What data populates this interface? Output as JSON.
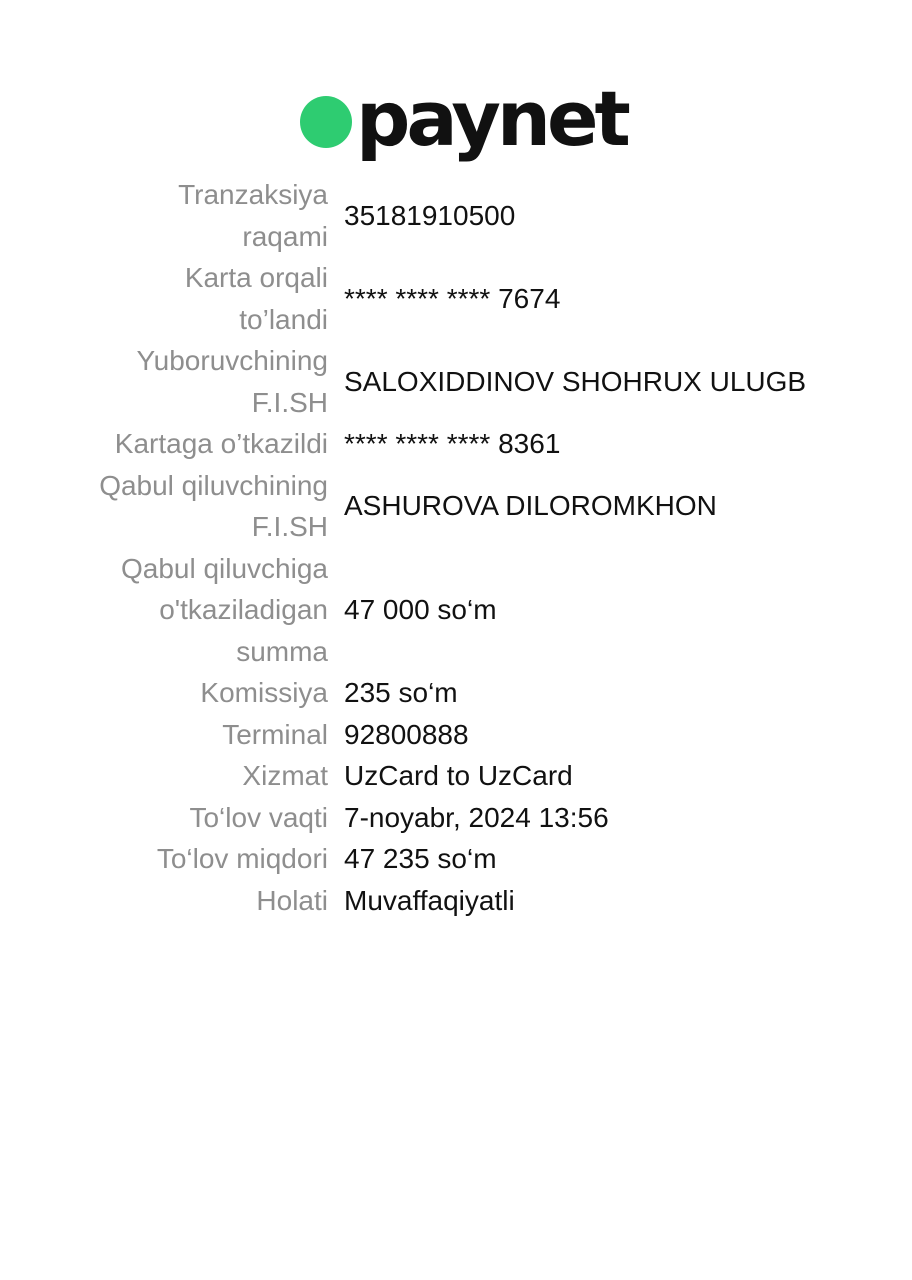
{
  "brand": {
    "name": "paynet",
    "accent_color": "#2ecc71"
  },
  "receipt": {
    "rows": [
      {
        "label": "Tranzaksiya raqami",
        "value": "35181910500"
      },
      {
        "label": "Karta orqali to’landi",
        "value": "**** **** **** 7674"
      },
      {
        "label": "Yuboruvchining F.I.SH",
        "value": "SALOXIDDINOV SHOHRUX ULUGB"
      },
      {
        "label": "Kartaga o’tkazildi",
        "value": "**** **** **** 8361"
      },
      {
        "label": "Qabul qiluvchining F.I.SH",
        "value": "ASHUROVA DILOROMKHON"
      },
      {
        "label": "Qabul qiluvchiga o'tkaziladigan summa",
        "value": "47 000 so‘m"
      },
      {
        "label": "Komissiya",
        "value": "235 so‘m"
      },
      {
        "label": "Terminal",
        "value": "92800888"
      },
      {
        "label": "Xizmat",
        "value": "UzCard to UzCard"
      },
      {
        "label": "To‘lov vaqti",
        "value": "7-noyabr, 2024 13:56"
      },
      {
        "label": "To‘lov miqdori",
        "value": "47 235 so‘m"
      },
      {
        "label": "Holati",
        "value": "Muvaffaqiyatli"
      }
    ]
  }
}
